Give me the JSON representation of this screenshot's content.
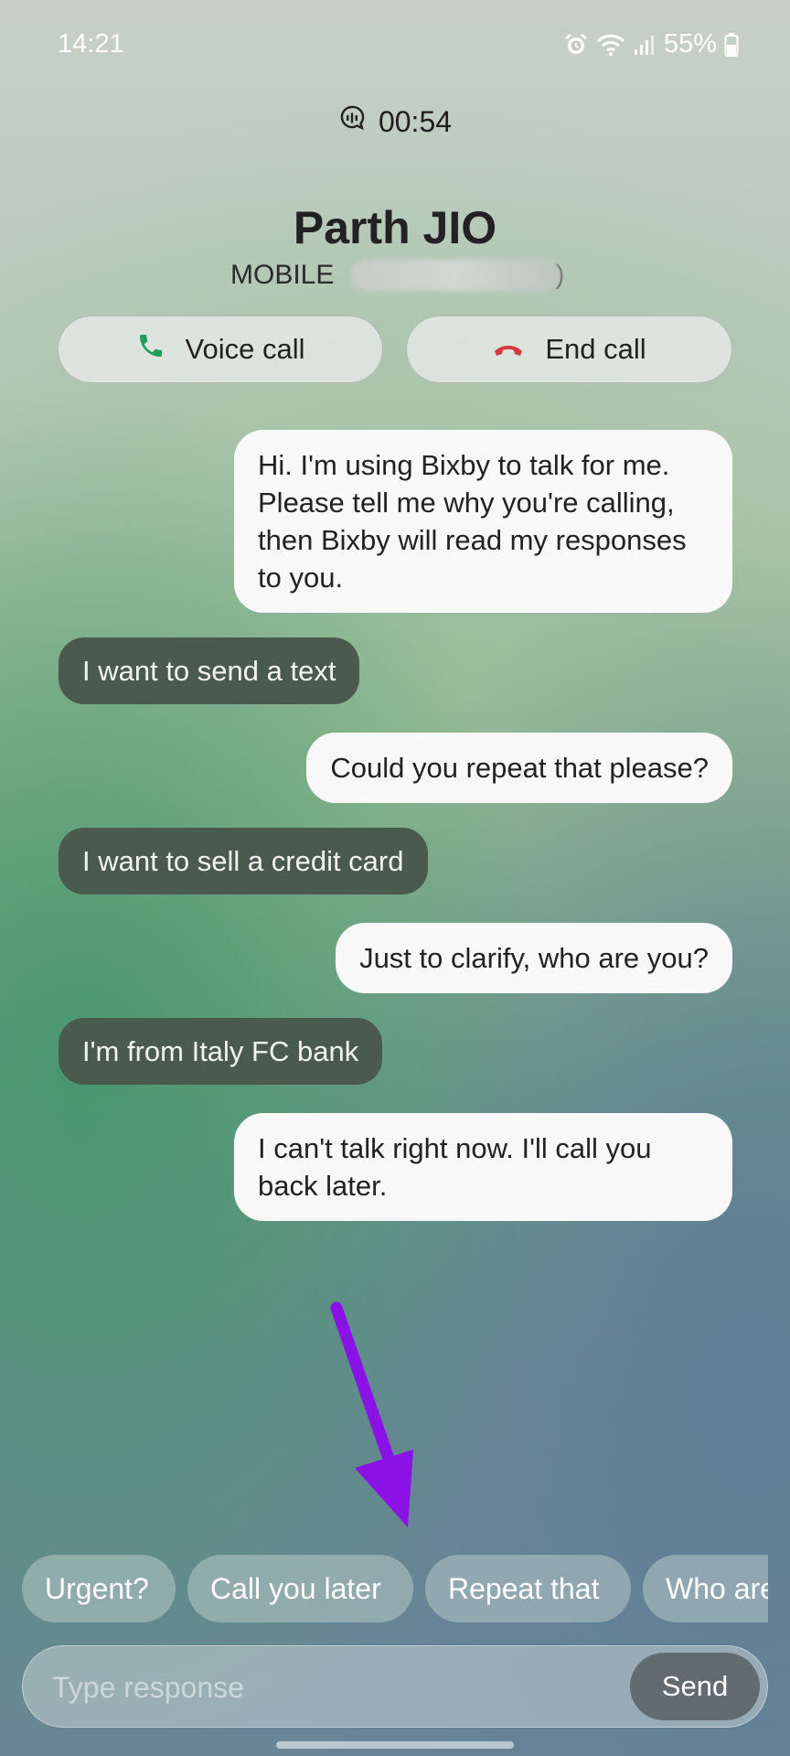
{
  "status_bar": {
    "time": "14:21",
    "battery": "55%"
  },
  "call": {
    "timer": "00:54",
    "contact_name": "Parth JIO",
    "number_label": "MOBILE",
    "number_tail": ")"
  },
  "actions": {
    "voice_call": "Voice call",
    "end_call": "End call"
  },
  "messages": [
    {
      "from": "bixby",
      "text": "Hi. I'm using Bixby to talk for me. Please tell me why you're calling, then Bixby will read my responses to you."
    },
    {
      "from": "caller",
      "text": "I want to send a text"
    },
    {
      "from": "bixby",
      "text": "Could you repeat that please?"
    },
    {
      "from": "caller",
      "text": "I want to sell a credit card"
    },
    {
      "from": "bixby",
      "text": "Just to clarify, who are you?"
    },
    {
      "from": "caller",
      "text": "I'm from Italy FC bank"
    },
    {
      "from": "bixby",
      "text": "I can't talk right now. I'll call you back later."
    }
  ],
  "quick_replies": [
    "Urgent?",
    "Call you later",
    "Repeat that",
    "Who are"
  ],
  "composer": {
    "placeholder": "Type response",
    "send_label": "Send"
  },
  "colors": {
    "accent_call": "#1f9e5a",
    "end_call": "#d43a3a",
    "annotation_arrow": "#8a12e6"
  }
}
